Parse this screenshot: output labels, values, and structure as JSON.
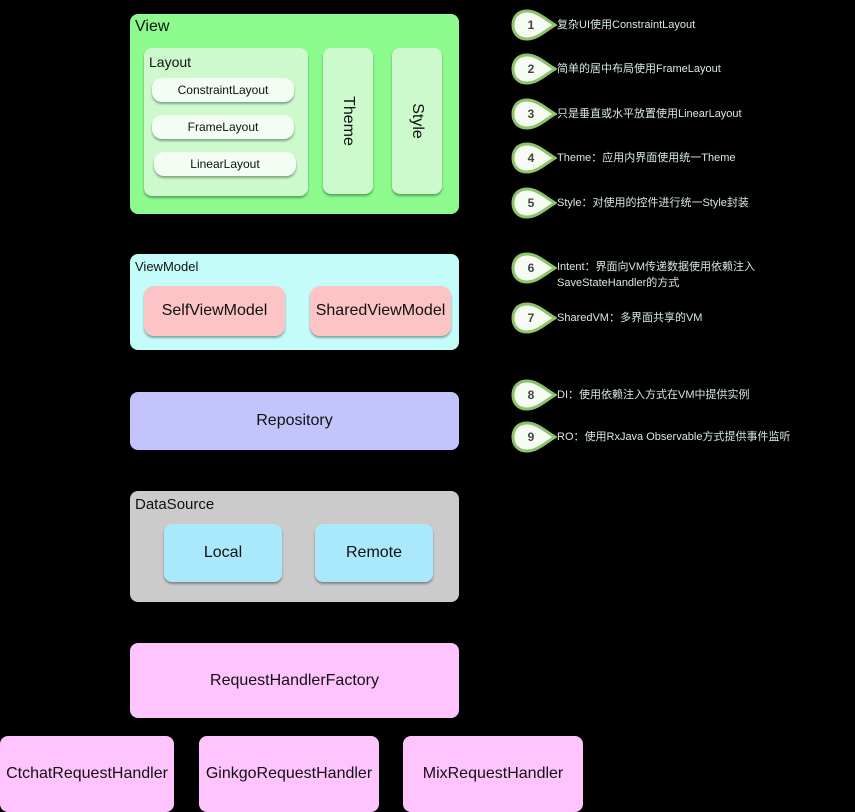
{
  "colors": {
    "background": "#000000",
    "view": "#8cfa8c",
    "view_inner": "#ccfacc",
    "viewmodel": "#c4fcfa",
    "viewmodel_item": "#fcc4c4",
    "repository": "#c4c4fc",
    "datasource": "#cbcbcb",
    "datasource_item": "#a9e9fb",
    "request_handler": "#ffc4fe",
    "badge_border": "#8dc46a"
  },
  "view": {
    "title": "View",
    "layout": {
      "title": "Layout",
      "items": [
        "ConstraintLayout",
        "FrameLayout",
        "LinearLayout"
      ]
    },
    "theme": "Theme",
    "style": "Style"
  },
  "viewmodel": {
    "title": "ViewModel",
    "items": [
      "SelfViewModel",
      "SharedViewModel"
    ]
  },
  "repository": {
    "label": "Repository"
  },
  "datasource": {
    "title": "DataSource",
    "items": [
      "Local",
      "Remote"
    ]
  },
  "request_handler_factory": {
    "label": "RequestHandlerFactory"
  },
  "handlers": [
    "CtchatRequestHandler",
    "GinkgoRequestHandler",
    "MixRequestHandler"
  ],
  "notes": [
    {
      "num": "1",
      "text": "复杂UI使用ConstraintLayout"
    },
    {
      "num": "2",
      "text": "简单的居中布局使用FrameLayout"
    },
    {
      "num": "3",
      "text": "只是垂直或水平放置使用LinearLayout"
    },
    {
      "num": "4",
      "text": "Theme：应用内界面使用统一Theme"
    },
    {
      "num": "5",
      "text": "Style：对使用的控件进行统一Style封装"
    },
    {
      "num": "6",
      "text": "Intent：界面向VM传递数据使用依赖注入",
      "text2": "SaveStateHandler的方式"
    },
    {
      "num": "7",
      "text": "SharedVM：多界面共享的VM"
    },
    {
      "num": "8",
      "text": "DI：使用依赖注入方式在VM中提供实例"
    },
    {
      "num": "9",
      "text": "RO：使用RxJava Observable方式提供事件监听"
    }
  ]
}
